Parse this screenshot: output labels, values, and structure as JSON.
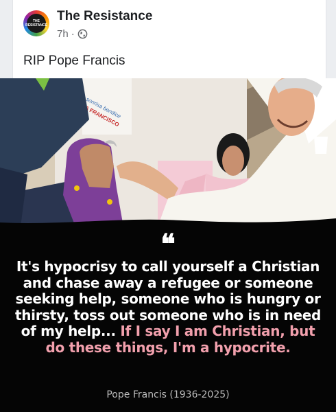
{
  "post": {
    "page_name": "The Resistance",
    "avatar_text": "THE RESISTANCE",
    "timestamp": "7h",
    "separator": "·",
    "audience_icon": "globe-icon",
    "text": "RIP Pope Francis"
  },
  "graphic": {
    "sign_text_1": "Tu sonrisa bendice",
    "sign_text_2": "PAPA FRANCISCO",
    "quote_mark": "❝",
    "quote_white": "It's hypocrisy to call yourself a Christian and chase away a refugee or someone seeking help, someone who is hungry or thirsty, toss out someone who is in need of my help... ",
    "quote_highlight": "If I say I am Christian, but do these things, I'm a hypocrite.",
    "attribution": "Pope Francis (1936-2025)",
    "highlight_color": "#f2a0ad"
  }
}
